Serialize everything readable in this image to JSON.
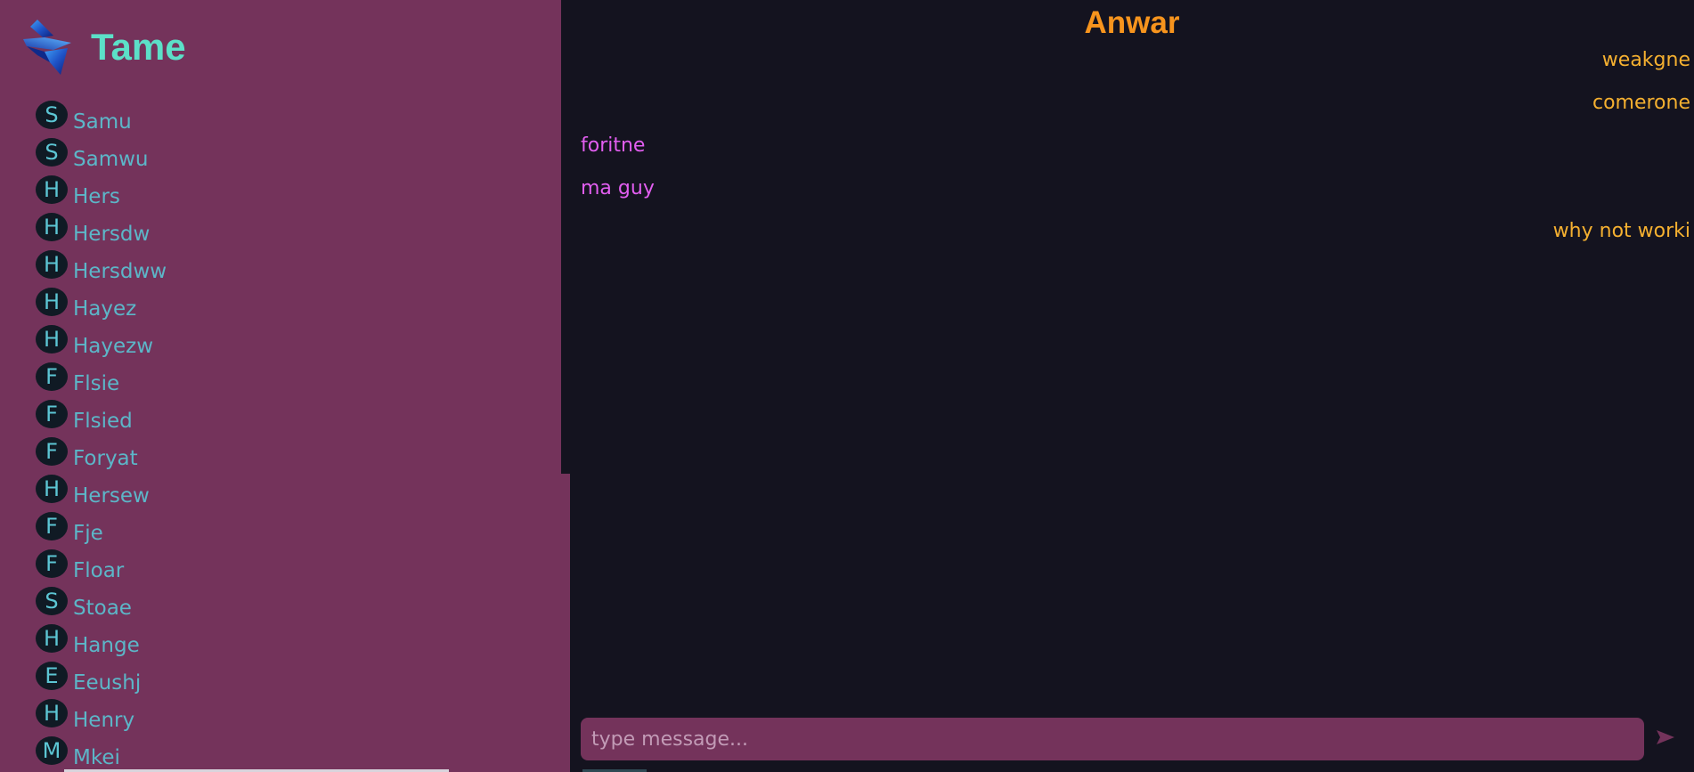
{
  "brand": {
    "name": "Tame",
    "logo_icon": "blue-ribbon-logo-icon"
  },
  "users": [
    {
      "initial": "S",
      "name": "Samu"
    },
    {
      "initial": "S",
      "name": "Samwu"
    },
    {
      "initial": "H",
      "name": "Hers"
    },
    {
      "initial": "H",
      "name": "Hersdw"
    },
    {
      "initial": "H",
      "name": "Hersdww"
    },
    {
      "initial": "H",
      "name": "Hayez"
    },
    {
      "initial": "H",
      "name": "Hayezw"
    },
    {
      "initial": "F",
      "name": "Flsie"
    },
    {
      "initial": "F",
      "name": "Flsied"
    },
    {
      "initial": "F",
      "name": "Foryat"
    },
    {
      "initial": "H",
      "name": "Hersew"
    },
    {
      "initial": "F",
      "name": "Fje"
    },
    {
      "initial": "F",
      "name": "Floar"
    },
    {
      "initial": "S",
      "name": "Stoae"
    },
    {
      "initial": "H",
      "name": "Hange"
    },
    {
      "initial": "E",
      "name": "Eeushj"
    },
    {
      "initial": "H",
      "name": "Henry"
    },
    {
      "initial": "M",
      "name": "Mkei"
    }
  ],
  "chat": {
    "title": "Anwar",
    "messages": [
      {
        "text": "weakgne",
        "direction": "out"
      },
      {
        "text": "comerone",
        "direction": "out"
      },
      {
        "text": "foritne",
        "direction": "in"
      },
      {
        "text": "ma guy",
        "direction": "in"
      },
      {
        "text": "why not worki",
        "direction": "out"
      }
    ],
    "composer": {
      "placeholder": "type message...",
      "value": ""
    },
    "send_icon": "send-arrow-icon"
  },
  "colors": {
    "sidebar_bg": "#74335b",
    "chat_bg": "#14131f",
    "brand": "#5ce0c8",
    "title": "#f7941d",
    "outgoing": "#f5b030",
    "incoming": "#e25ef0",
    "user_name": "#5cb6c8"
  }
}
